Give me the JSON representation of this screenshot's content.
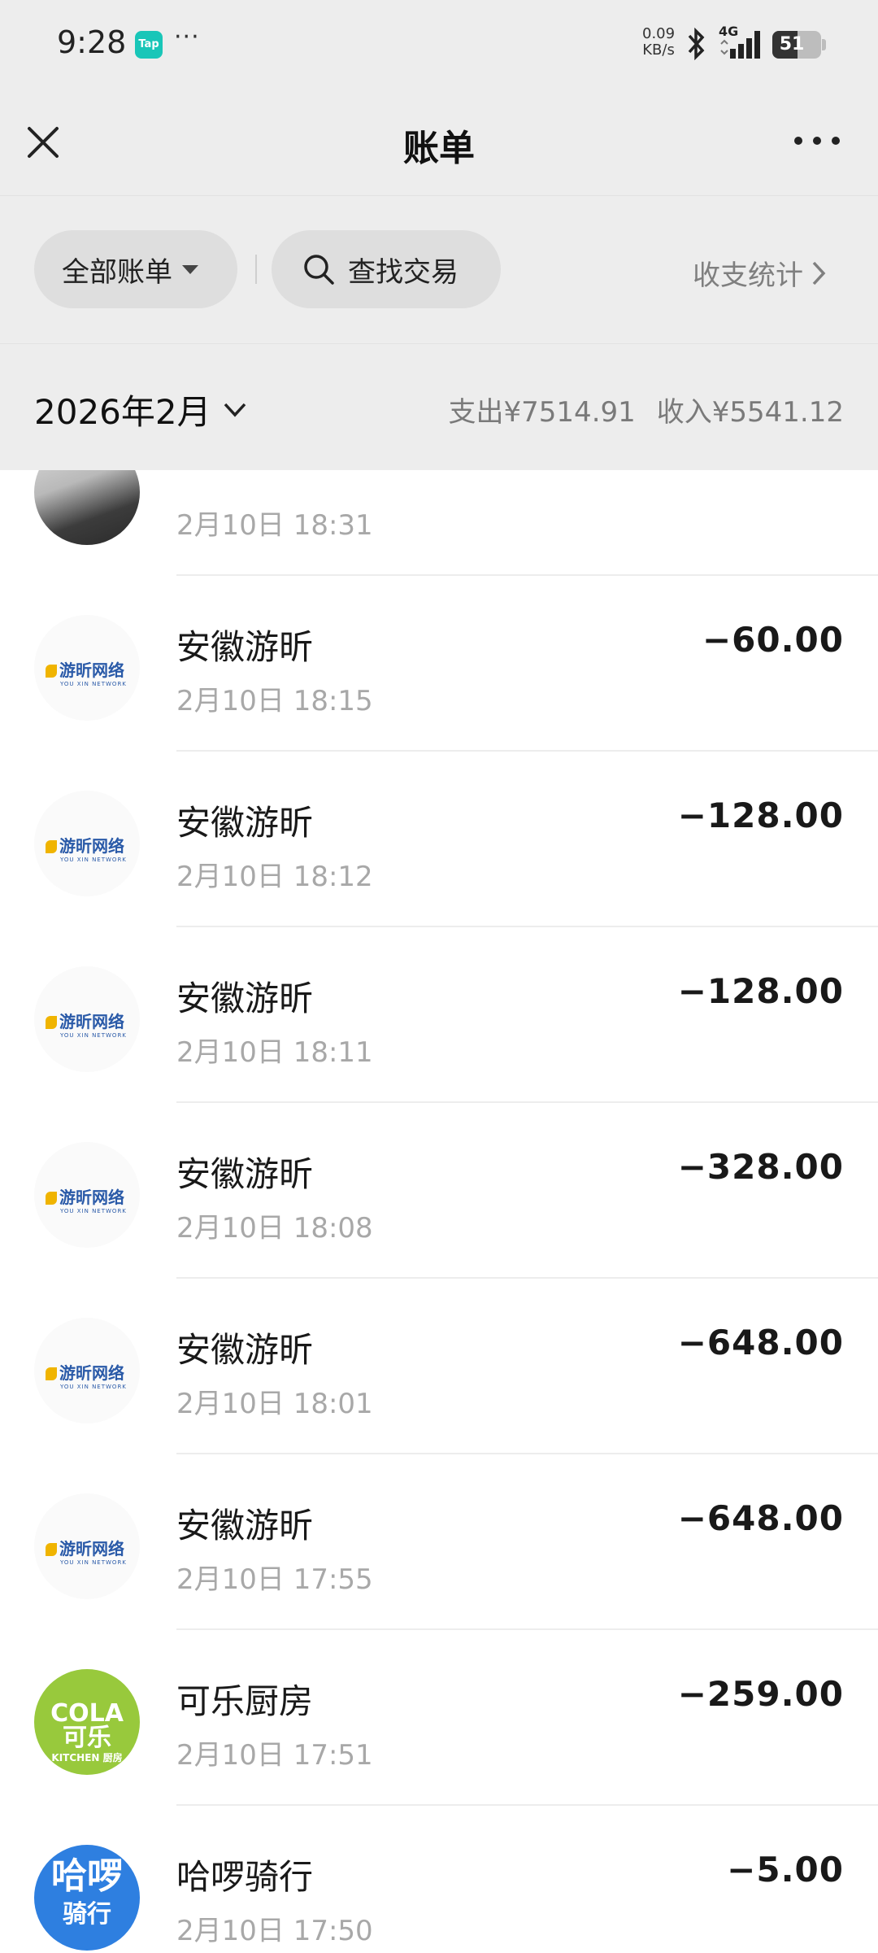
{
  "status_bar": {
    "time": "9:28",
    "tap_badge": "Tap",
    "more_dots": "···",
    "net_speed_value": "0.09",
    "net_speed_unit": "KB/s",
    "network_type": "4G",
    "battery_level": 51,
    "battery_text": "51"
  },
  "header": {
    "title": "账单",
    "close_icon": "close-icon",
    "more_icon": "more-horizontal-icon"
  },
  "filters": {
    "all_bills_label": "全部账单",
    "search_label": "查找交易",
    "stats_label": "收支统计"
  },
  "month": {
    "label": "2026年2月",
    "expense": "支出¥7514.91",
    "income": "收入¥5541.12"
  },
  "transactions": [
    {
      "name": "",
      "time": "2月10日 18:31",
      "amount": "",
      "avatar": "photo"
    },
    {
      "name": "安徽游昕",
      "time": "2月10日 18:15",
      "amount": "−60.00",
      "avatar": "youxin"
    },
    {
      "name": "安徽游昕",
      "time": "2月10日 18:12",
      "amount": "−128.00",
      "avatar": "youxin"
    },
    {
      "name": "安徽游昕",
      "time": "2月10日 18:11",
      "amount": "−128.00",
      "avatar": "youxin"
    },
    {
      "name": "安徽游昕",
      "time": "2月10日 18:08",
      "amount": "−328.00",
      "avatar": "youxin"
    },
    {
      "name": "安徽游昕",
      "time": "2月10日 18:01",
      "amount": "−648.00",
      "avatar": "youxin"
    },
    {
      "name": "安徽游昕",
      "time": "2月10日 17:55",
      "amount": "−648.00",
      "avatar": "youxin"
    },
    {
      "name": "可乐厨房",
      "time": "2月10日 17:51",
      "amount": "−259.00",
      "avatar": "kola"
    },
    {
      "name": "哈啰骑行",
      "time": "2月10日 17:50",
      "amount": "−5.00",
      "avatar": "halo"
    }
  ],
  "logos": {
    "youxin_main": "游昕网络",
    "youxin_sub": "YOU XIN NETWORK",
    "kola_main": "COLA 可乐",
    "kola_sub": "KITCHEN 厨房",
    "halo_line1": "哈啰",
    "halo_line2": "骑行"
  }
}
